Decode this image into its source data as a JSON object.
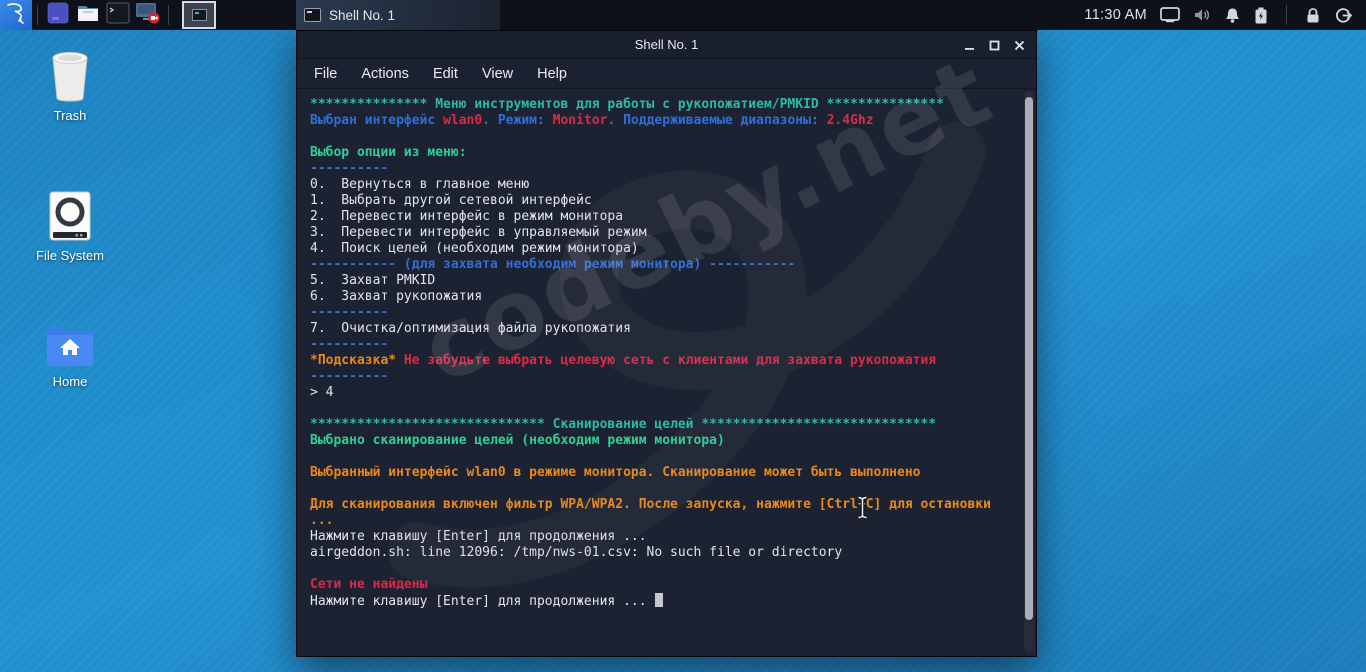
{
  "taskbar": {
    "clock": "11:30 AM",
    "task_button": {
      "label": "Shell No. 1"
    },
    "icons": [
      "kali-menu",
      "show-desktop",
      "file-manager",
      "terminal",
      "screen-recorder",
      "workspace-pager",
      "display",
      "volume-muted",
      "notifications",
      "battery-charging",
      "screen-lock",
      "log-out"
    ]
  },
  "window": {
    "title": "Shell No. 1",
    "menu": {
      "file": "File",
      "actions": "Actions",
      "edit": "Edit",
      "view": "View",
      "help": "Help"
    }
  },
  "desktop": {
    "icons": [
      {
        "label": "Trash"
      },
      {
        "label": "File System"
      },
      {
        "label": "Home"
      }
    ]
  },
  "watermark": {
    "text": "codeby.net"
  },
  "colors": {
    "desktop_blue": "#2190cf",
    "kali_tile_blue": "#2f7be0",
    "terminal_bg": "#1c2231",
    "taskbar_bg": "#0e1119"
  },
  "terminal": {
    "palette": {
      "w": "#e2e5ec",
      "c": "#2eb8a8",
      "g": "#31cf97",
      "b": "#2f6fd8",
      "r": "#d92b47",
      "o": "#e8891c"
    },
    "lines": [
      {
        "s": [
          {
            "c": "c",
            "t": "*************** Меню инструментов для работы с рукопожатием/PMKID ***************"
          }
        ]
      },
      {
        "s": [
          {
            "c": "b",
            "t": "Выбран интерфейс "
          },
          {
            "c": "r",
            "t": "wlan0"
          },
          {
            "c": "b",
            "t": ". Режим: "
          },
          {
            "c": "r",
            "t": "Monitor"
          },
          {
            "c": "b",
            "t": ". Поддерживаемые диапазоны: "
          },
          {
            "c": "r",
            "t": "2.4Ghz"
          }
        ]
      },
      {
        "s": []
      },
      {
        "s": [
          {
            "c": "g",
            "t": "Выбор опции из меню:"
          }
        ]
      },
      {
        "s": [
          {
            "c": "b",
            "t": "----------"
          }
        ]
      },
      {
        "s": [
          {
            "c": "w",
            "t": "0.  Вернуться в главное меню"
          }
        ]
      },
      {
        "s": [
          {
            "c": "w",
            "t": "1.  Выбрать другой сетевой интерфейс"
          }
        ]
      },
      {
        "s": [
          {
            "c": "w",
            "t": "2.  Перевести интерфейс в режим монитора"
          }
        ]
      },
      {
        "s": [
          {
            "c": "w",
            "t": "3.  Перевести интерфейс в управляемый режим"
          }
        ]
      },
      {
        "s": [
          {
            "c": "w",
            "t": "4.  Поиск целей (необходим режим монитора)"
          }
        ]
      },
      {
        "s": [
          {
            "c": "b",
            "t": "----------- (для захвата необходим режим монитора) -----------"
          }
        ]
      },
      {
        "s": [
          {
            "c": "w",
            "t": "5.  Захват PMKID"
          }
        ]
      },
      {
        "s": [
          {
            "c": "w",
            "t": "6.  Захват рукопожатия"
          }
        ]
      },
      {
        "s": [
          {
            "c": "b",
            "t": "----------"
          }
        ]
      },
      {
        "s": [
          {
            "c": "w",
            "t": "7.  Очистка/оптимизация файла рукопожатия"
          }
        ]
      },
      {
        "s": [
          {
            "c": "b",
            "t": "----------"
          }
        ]
      },
      {
        "s": [
          {
            "c": "o",
            "t": "*Подсказка* "
          },
          {
            "c": "r",
            "t": "Не забудьте выбрать целевую сеть с клиентами для захвата рукопожатия"
          }
        ]
      },
      {
        "s": [
          {
            "c": "b",
            "t": "----------"
          }
        ]
      },
      {
        "s": [
          {
            "c": "w",
            "t": "> 4"
          }
        ]
      },
      {
        "s": []
      },
      {
        "s": [
          {
            "c": "c",
            "t": "****************************** Сканирование целей ******************************"
          }
        ]
      },
      {
        "s": [
          {
            "c": "g",
            "t": "Выбрано сканирование целей (необходим режим монитора)"
          }
        ]
      },
      {
        "s": []
      },
      {
        "s": [
          {
            "c": "o",
            "t": "Выбранный интерфейс wlan0 в режиме монитора. Сканирование может быть выполнено"
          }
        ]
      },
      {
        "s": []
      },
      {
        "s": [
          {
            "c": "o",
            "t": "Для сканирования включен фильтр WPA/WPA2. После запуска, нажмите [Ctrl+C] для остановки"
          }
        ]
      },
      {
        "s": [
          {
            "c": "o",
            "t": "..."
          }
        ]
      },
      {
        "s": [
          {
            "c": "w",
            "t": "Нажмите клавишу [Enter] для продолжения ..."
          }
        ]
      },
      {
        "s": [
          {
            "c": "w",
            "t": "airgeddon.sh: line 12096: /tmp/nws-01.csv: No such file or directory"
          }
        ]
      },
      {
        "s": []
      },
      {
        "s": [
          {
            "c": "r",
            "t": "Сети не найдены"
          }
        ]
      },
      {
        "s": [
          {
            "c": "w",
            "t": "Нажмите клавишу [Enter] для продолжения ... "
          }
        ],
        "cursor": true
      }
    ]
  }
}
